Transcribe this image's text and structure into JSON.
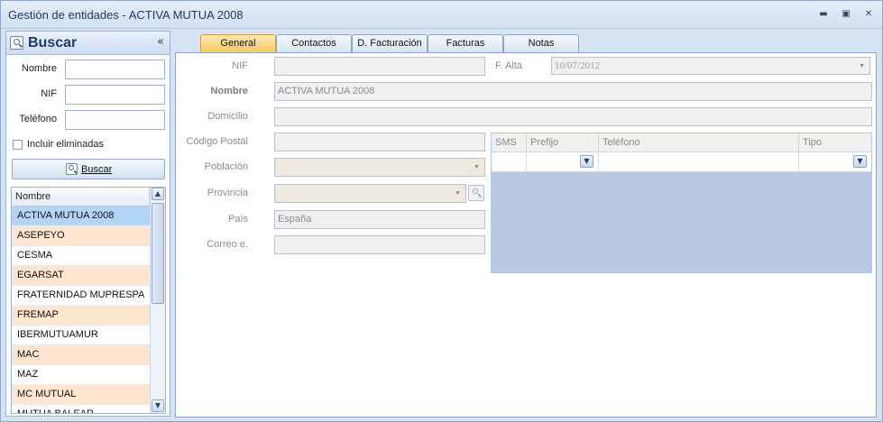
{
  "window": {
    "title": "Gestión de entidades - ACTIVA MUTUA 2008",
    "controls": [
      "minimize-icon",
      "restore-icon",
      "close-icon"
    ]
  },
  "search_panel": {
    "title": "Buscar",
    "collapse_glyph": "«",
    "labels": {
      "nombre": "Nombre",
      "nif": "NIF",
      "telefono": "Teléfono"
    },
    "values": {
      "nombre": "",
      "nif": "",
      "telefono": ""
    },
    "include_deleted_label": "Incluir eliminadas",
    "include_deleted_checked": false,
    "search_button": "Buscar",
    "list_header": "Nombre",
    "list_items": [
      "ACTIVA MUTUA 2008",
      "ASEPEYO",
      "CESMA",
      "EGARSAT",
      "FRATERNIDAD MUPRESPA",
      "FREMAP",
      "IBERMUTUAMUR",
      "MAC",
      "MAZ",
      "MC MUTUAL",
      "MUTUA BALEAR"
    ],
    "selected_index": 0
  },
  "tabs": [
    "General",
    "Contactos",
    "D. Facturación",
    "Facturas",
    "Notas"
  ],
  "active_tab": "General",
  "form": {
    "nif_label": "NIF",
    "nif_value": "",
    "falta_label": "F. Alta",
    "falta_value": "10/07/2012",
    "nombre_label": "Nombre",
    "nombre_value": "ACTIVA MUTUA 2008",
    "domicilio_label": "Domicilio",
    "domicilio_value": "",
    "cp_label": "Código Postal",
    "cp_value": "",
    "poblacion_label": "Población",
    "poblacion_value": "",
    "provincia_label": "Provincia",
    "provincia_value": "",
    "pais_label": "País",
    "pais_value": "España",
    "correo_label": "Correo e.",
    "correo_value": ""
  },
  "phones_grid": {
    "columns": [
      "SMS",
      "Prefijo",
      "Teléfono",
      "Tipo"
    ],
    "row": {
      "sms": "",
      "prefijo": "",
      "telefono": "",
      "tipo": ""
    }
  }
}
